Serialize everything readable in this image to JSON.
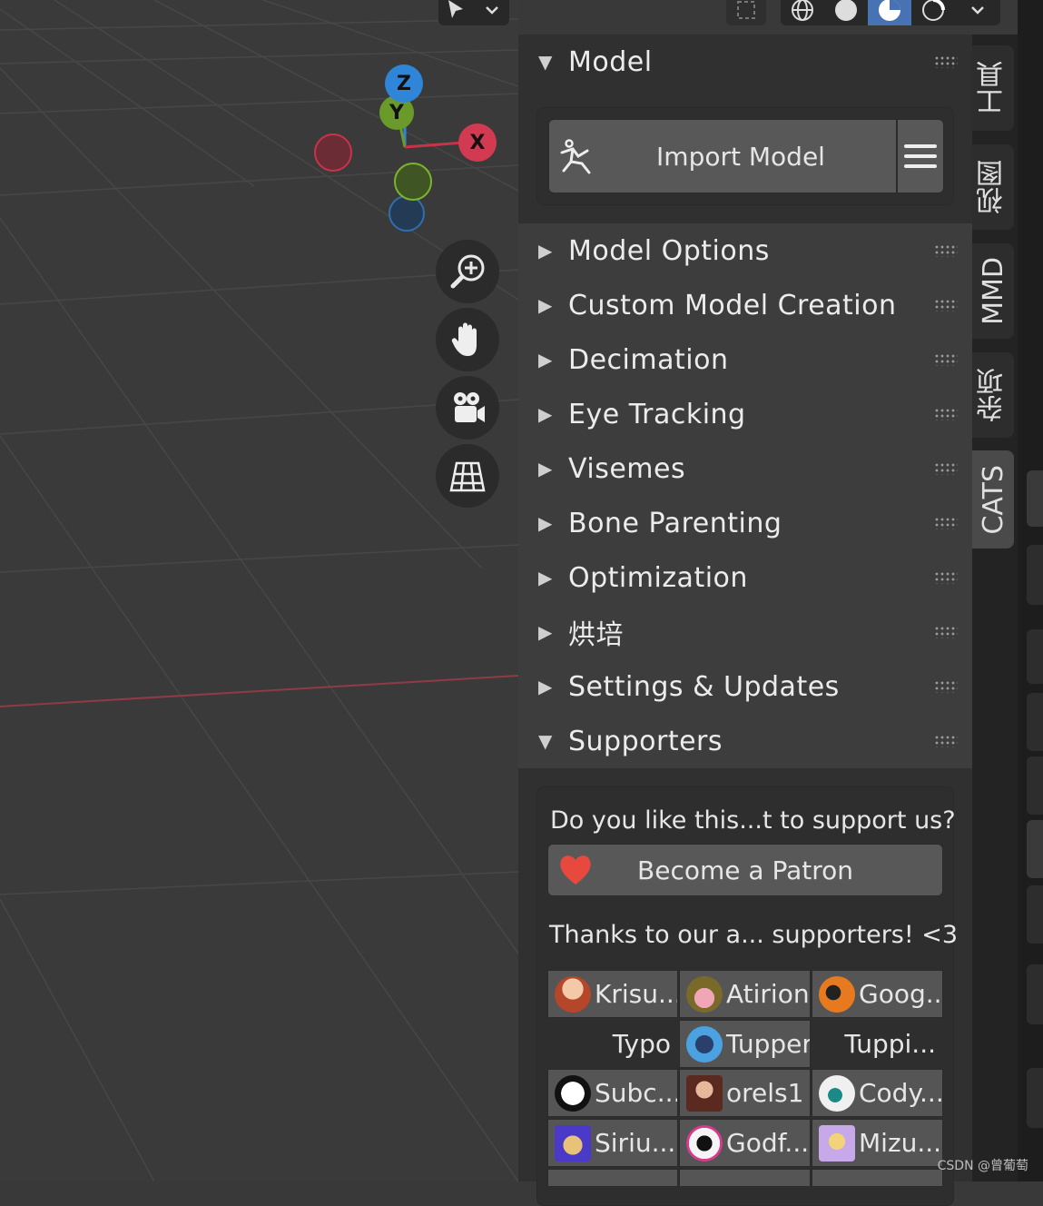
{
  "toolbar": {
    "dropdown_icon": "chevron-down-icon",
    "accent": "#4772b3"
  },
  "gizmo": {
    "x_label": "X",
    "y_label": "Y",
    "z_label": "Z",
    "colors": {
      "x": "#c7344a",
      "y": "#6a9a2a",
      "z": "#2f86d8"
    }
  },
  "nav_buttons": [
    "zoom-icon",
    "pan-hand-icon",
    "camera-icon",
    "ortho-grid-icon"
  ],
  "panel": {
    "model": {
      "title": "Model",
      "import_label": "Import Model"
    },
    "collapsed_sections": [
      "Model Options",
      "Custom Model Creation",
      "Decimation",
      "Eye Tracking",
      "Visemes",
      "Bone Parenting",
      "Optimization",
      "烘培",
      "Settings & Updates"
    ],
    "supporters": {
      "title": "Supporters",
      "question": "Do you like this...t to support us?",
      "patron_label": "Become a Patron",
      "thanks": "Thanks to our a... supporters! <3",
      "rows": [
        [
          {
            "name": "Krisu...",
            "avatar": true
          },
          {
            "name": "Atirion",
            "avatar": true
          },
          {
            "name": "Goog...",
            "avatar": true
          }
        ],
        [
          {
            "name": "Typo",
            "avatar": false
          },
          {
            "name": "Tupper",
            "avatar": true
          },
          {
            "name": "Tuppi...",
            "avatar": false
          }
        ],
        [
          {
            "name": "Subc...",
            "avatar": true
          },
          {
            "name": "orels1",
            "avatar": true
          },
          {
            "name": "Cody...",
            "avatar": true
          }
        ],
        [
          {
            "name": "Siriu...",
            "avatar": true
          },
          {
            "name": "Godf...",
            "avatar": true
          },
          {
            "name": "Mizu...",
            "avatar": true
          }
        ]
      ]
    }
  },
  "tabs": [
    "工具",
    "视图",
    "MMD",
    "杂项",
    "CATS"
  ],
  "active_tab": "CATS",
  "watermark": "CSDN @曾葡萄"
}
